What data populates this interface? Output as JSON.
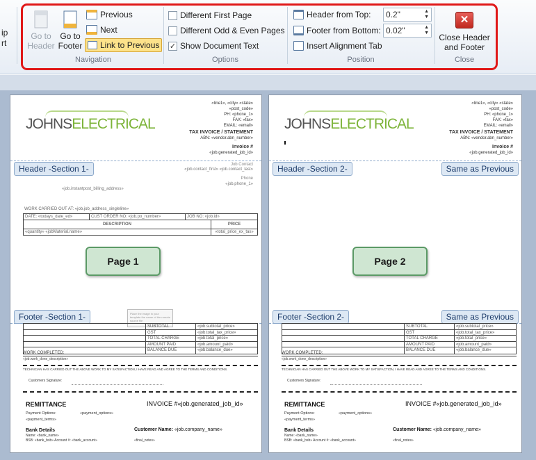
{
  "ribbon": {
    "partial_left": [
      "ip",
      "rt"
    ],
    "navigation": {
      "group_label": "Navigation",
      "go_to_header": [
        "Go to",
        "Header"
      ],
      "go_to_footer": [
        "Go to",
        "Footer"
      ],
      "previous": "Previous",
      "next": "Next",
      "link_to_previous": "Link to Previous"
    },
    "options": {
      "group_label": "Options",
      "different_first_page": "Different First Page",
      "different_odd_even": "Different Odd & Even Pages",
      "show_document_text": "Show Document Text"
    },
    "position": {
      "group_label": "Position",
      "header_from_top_label": "Header from Top:",
      "header_from_top_value": "0.2\"",
      "footer_from_bottom_label": "Footer from Bottom:",
      "footer_from_bottom_value": "0.02\"",
      "insert_alignment_tab": "Insert Alignment Tab"
    },
    "close": {
      "group_label": "Close",
      "button": [
        "Close Header",
        "and Footer"
      ]
    }
  },
  "pages": [
    {
      "header_tag": "Header -Section 1-",
      "footer_tag": "Footer -Section 1-",
      "page_label": "Page 1"
    },
    {
      "header_tag": "Header -Section 2-",
      "footer_tag": "Footer -Section 2-",
      "page_label": "Page 2",
      "same_as_previous": "Same as Previous"
    }
  ],
  "doc": {
    "logo_a": "JOHNS",
    "logo_b": "ELECTRICAL",
    "addr": [
      "«line1», «city» «state»",
      "«post_code»",
      "PH: «phone_1»",
      "FAX: «fax»",
      "EMAIL: «email»"
    ],
    "tax_invoice": "TAX INVOICE / STATEMENT",
    "abn": "ABN: «vendor.abn_number»",
    "invoice_no": "Invoice #",
    "invoice_id": "«job.generated_job_id»",
    "job_contact": "Job Contact",
    "contact_name": "«job.contact_first» «job.contact_last»",
    "phone_label": "Phone",
    "phone_val": "«job.phone_1»",
    "billing": "«job.instantpost_billing_address»",
    "work_carried": "WORK CARRIED OUT AT: «job.job_address_singleline»",
    "date": "DATE: «todays_date_ed»",
    "cust_order": "CUST ORDER NO: «job.po_number»",
    "job_no": "JOB NO: «job.id»",
    "desc_head": "DESCRIPTION",
    "price_head": "PRICE",
    "material_line": "«quantity» «jobMaterial.name»",
    "material_price": "«total_price_ex_tax»",
    "totals": [
      [
        "SUBTOTAL",
        "«job.subtotal_price»"
      ],
      [
        "GST",
        "«job.total_tax_price»"
      ],
      [
        "TOTAL CHARGE",
        "«job.total_price»"
      ],
      [
        "AMOUNT PAID",
        "«job.amount_paid»"
      ],
      [
        "BALANCE DUE",
        "«job.balance_due»"
      ]
    ],
    "work_completed": "WORK COMPLETED:",
    "work_done": "«job.work_done_description»",
    "technician": "TECHNICIAN HAS CARRIED OUT THE ABOVE WORK TO MY SATISFACTION, I HAVE READ AND AGREE TO THE TERMS AND CONDITIONS.",
    "cust_sig": "Customers  Signature:",
    "remittance": "REMITTANCE",
    "invoice_hash": "INVOICE #«job.generated_job_id»",
    "payment_options": "Payment Options:",
    "payment_options_val": "«payment_options»",
    "payment_terms": "«payment_terms»",
    "bank_details": "Bank Details",
    "bank_name": "Name: «bank_name»",
    "bank_bsb": "BSB: «bank_bsb»   Account #: «bank_account»",
    "customer_name": "Customer  Name:",
    "company_name": "«job.company_name»",
    "final_notes": "«final_notes»",
    "img_text": "Place the image in your template the name of the remote source file"
  }
}
